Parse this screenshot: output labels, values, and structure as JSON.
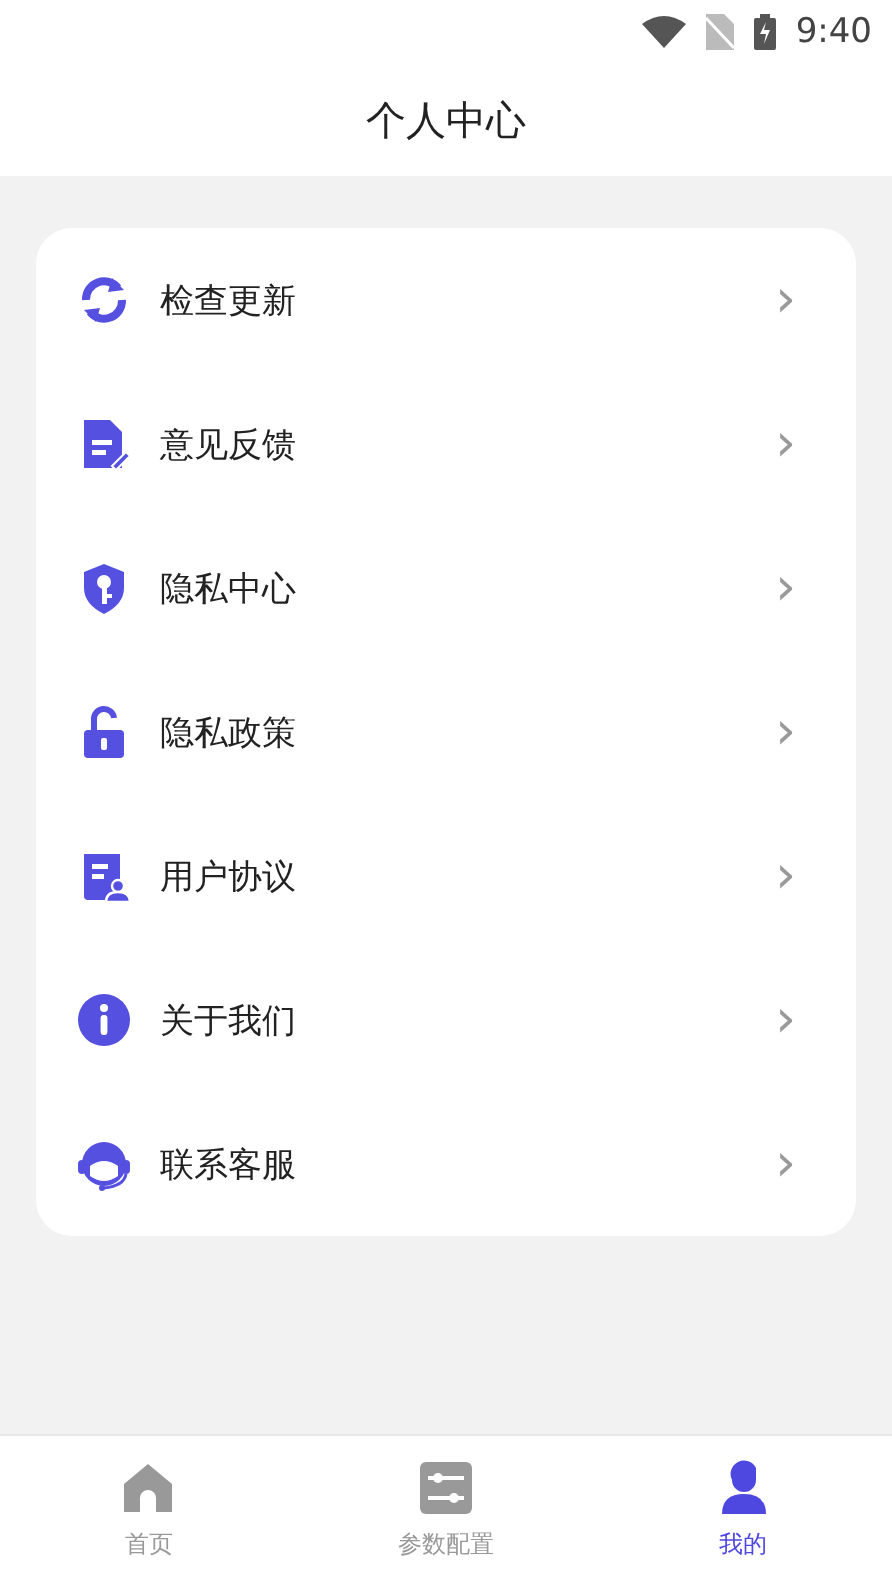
{
  "status_bar": {
    "time": "9:40"
  },
  "header": {
    "title": "个人中心"
  },
  "menu": [
    {
      "kind": "refresh",
      "label": "检查更新",
      "chevron": "›"
    },
    {
      "kind": "document",
      "label": "意见反馈",
      "chevron": "›"
    },
    {
      "kind": "shield",
      "label": "隐私中心",
      "chevron": "›"
    },
    {
      "kind": "lock",
      "label": "隐私政策",
      "chevron": "›"
    },
    {
      "kind": "contract",
      "label": "用户协议",
      "chevron": "›"
    },
    {
      "kind": "info",
      "label": "关于我们",
      "chevron": "›"
    },
    {
      "kind": "headset",
      "label": "联系客服",
      "chevron": "›"
    }
  ],
  "tabs": [
    {
      "kind": "home",
      "label": "首页",
      "selected": false
    },
    {
      "kind": "sliders",
      "label": "参数配置",
      "selected": false
    },
    {
      "kind": "person",
      "label": "我的",
      "selected": true
    }
  ]
}
